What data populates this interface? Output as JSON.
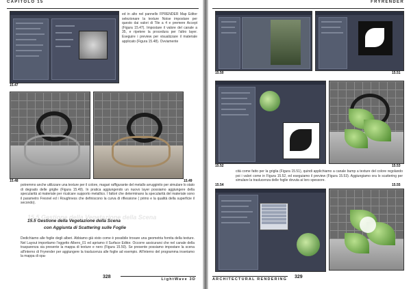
{
  "left_page": {
    "header": "Capitolo 15",
    "footer": "LightWave 3D",
    "page_number": "328",
    "figures": {
      "f47": "15.47",
      "f48": "15.48",
      "f49": "15.49"
    },
    "col_text": "ed in alto nel pannello FPRENDER Map Editor selezionare la texture Noise impostare per questo dai valori di Tile a 4 e premere Accept (Figura 15.47). Impostare il valore del canale a 35, e ripetere la procedura per l'altro layer. Eseguire i preview per visualizzare il materiale applicato (Figura 15.48). Ovviamente",
    "body_text": "potremmo anche utilizzare una texture per il colore, magari raffigurante del metallo arrugginito per simulare lo stato di degrado delle griglie (Figura 15.49). In pratica aggiungendo un nuovo layer possiamo aggiungere della specularità al materiale per ricalcare supporto metallico. I fattori che determinano la specularità del materiale sono il parametro Fresnel ed i Roughness che definiscono la curva di riflessione ( primo e la qualità della superficie il secondo).",
    "section_ghost": "15.5 Gestione della Vegetazione della Scena",
    "section_title_1": "15.5 Gestione della Vegetazione della Scena",
    "section_title_2": "con Aggiunta di Scattering sulle Foglie",
    "section_text": "Dedichiamo alle foglie degli alberi. Abbiamo già visto come è possibile trovare una geometria fornita della texture. Nel Layout importiamo l'oggetto Albero_01 ed apriamo il Surface Editor. Occorre assicurarsi che nel canale della trasparenza sia presente la mappa di texture e nero (Figura 15.50). Se presente possiamo impostare la scena all'interno di Fryrender per aggiungere la traslucenza alle foglie ad esempio. All'interno del programma inseriamo la mappa di opa-"
  },
  "right_page": {
    "header": "Fryrender",
    "footer": "Architectural Rendering",
    "page_number": "329",
    "figures": {
      "f50": "15.50",
      "f51": "15.51",
      "f52": "15.52",
      "f53": "15.53",
      "f54": "15.54",
      "f55": "15.55"
    },
    "body_text": "cità come fatto per la griglia (Figura 15.51), quindi applichiamo a canale bump a texture del colore regolando poi i valori come in Figura 15.52, ed eseguiamo il preview (Figura 15.53). Aggiungiamo ora lo scattering per simulare la traslucenza delle foglie dovuta ai loro spessore."
  }
}
